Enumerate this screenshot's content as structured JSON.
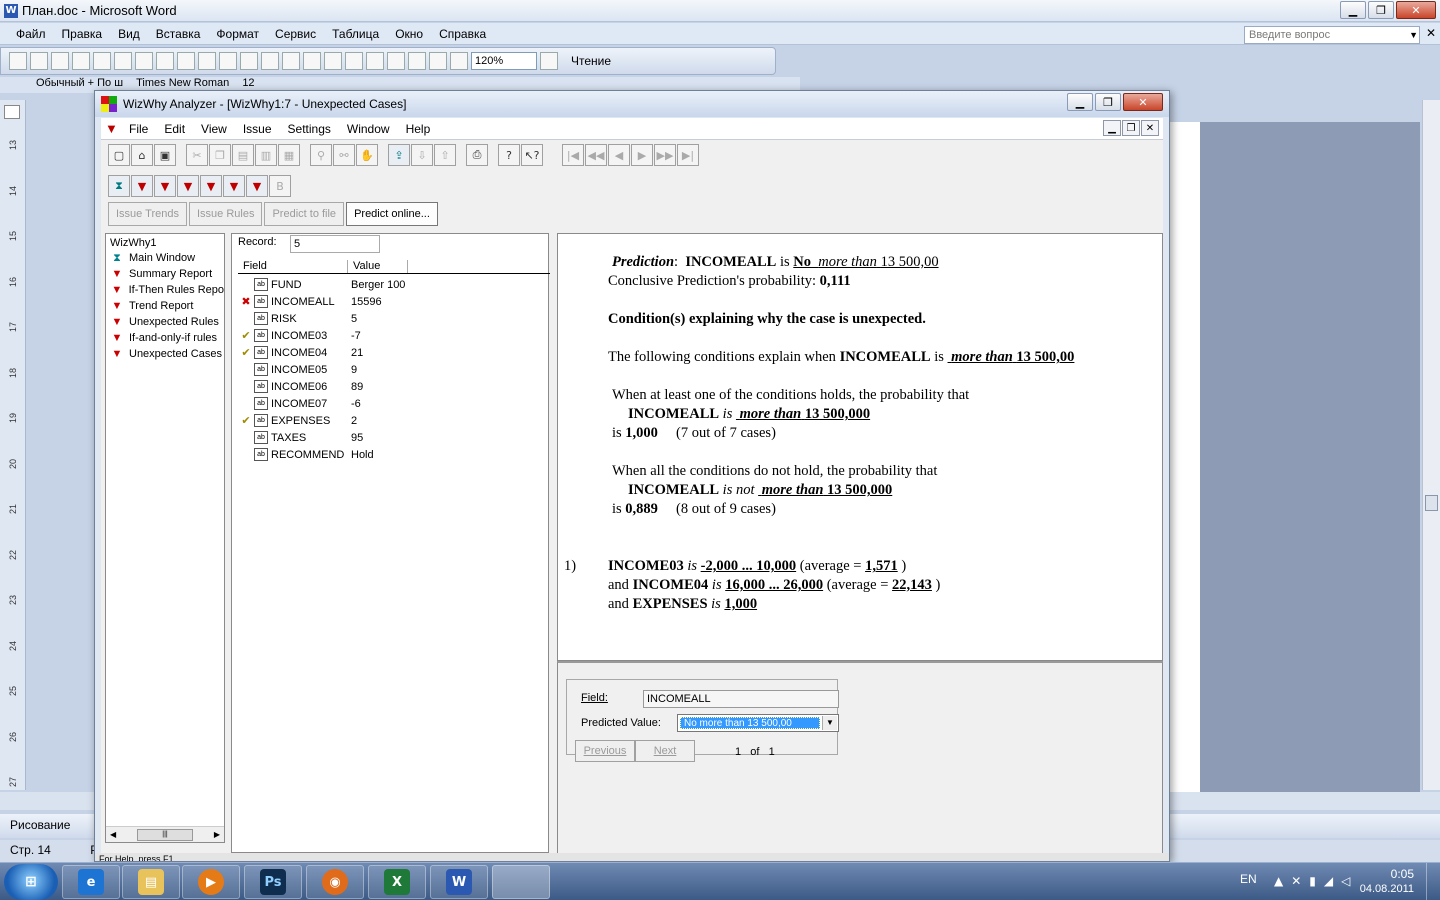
{
  "word": {
    "title": "План.doc - Microsoft Word",
    "menu": [
      "Файл",
      "Правка",
      "Вид",
      "Вставка",
      "Формат",
      "Сервис",
      "Таблица",
      "Окно",
      "Справка"
    ],
    "ask_placeholder": "Введите вопрос",
    "zoom": "120%",
    "read_label": "Чтение",
    "style_combo": "Обычный + По ш",
    "font_combo": "Times New Roman",
    "size_combo": "12",
    "ruler_numbers": [
      "13",
      "14",
      "15",
      "16",
      "17",
      "18",
      "19",
      "20",
      "21",
      "22",
      "23",
      "24",
      "25",
      "26",
      "27"
    ],
    "draw_label": "Рисование",
    "status_page": "Стр. 14",
    "status_number": "Р"
  },
  "wiz": {
    "title": "WizWhy Analyzer - [WizWhy1:7 - Unexpected Cases]",
    "menu": [
      "File",
      "Edit",
      "View",
      "Issue",
      "Settings",
      "Window",
      "Help"
    ],
    "action_buttons": [
      "Issue Trends",
      "Issue Rules",
      "Predict to file",
      "Predict online..."
    ],
    "tree": {
      "root": "WizWhy1",
      "items": [
        "Main Window",
        "Summary Report",
        "If-Then Rules Repo",
        "Trend Report",
        "Unexpected Rules",
        "If-and-only-if rules",
        "Unexpected Cases"
      ]
    },
    "record": {
      "label": "Record:",
      "value": "5",
      "col_field": "Field",
      "col_value": "Value",
      "rows": [
        {
          "mark": "",
          "field": "FUND",
          "value": "Berger 100"
        },
        {
          "mark": "x",
          "field": "INCOMEALL",
          "value": "15596"
        },
        {
          "mark": "",
          "field": "RISK",
          "value": "5"
        },
        {
          "mark": "ok",
          "field": "INCOME03",
          "value": "-7"
        },
        {
          "mark": "ok",
          "field": "INCOME04",
          "value": "21"
        },
        {
          "mark": "",
          "field": "INCOME05",
          "value": "9"
        },
        {
          "mark": "",
          "field": "INCOME06",
          "value": "89"
        },
        {
          "mark": "",
          "field": "INCOME07",
          "value": "-6"
        },
        {
          "mark": "ok",
          "field": "EXPENSES",
          "value": "2"
        },
        {
          "mark": "",
          "field": "TAXES",
          "value": "95"
        },
        {
          "mark": "",
          "field": "RECOMMEND",
          "value": "Hold"
        }
      ]
    },
    "doc": {
      "pred_label": "Prediction",
      "pred_colon": ":",
      "pred_field": "INCOMEALL",
      "is": "is",
      "pred_no": "No",
      "pred_more": "more than",
      "pred_amount": "13 500,00",
      "concl_text": "Conclusive Prediction's probability:",
      "concl_value": "0,111",
      "cond_heading": "Condition(s) explaining why the case is unexpected.",
      "following_text": "The following conditions explain when",
      "following_field": "INCOMEALL",
      "following_is": "is",
      "following_more": "more than",
      "following_amount": "13 500,00",
      "atleast_text": "When at least one of the conditions holds, the probability that",
      "atleast_field": "INCOMEALL",
      "atleast_is": "is",
      "atleast_more": "more than",
      "atleast_amount": "13 500,000",
      "atleast_prob_is": "is",
      "atleast_prob": "1,000",
      "atleast_cases": "(7 out of 7 cases)",
      "all_text": "When all the conditions do not hold, the probability that",
      "all_field": "INCOMEALL",
      "all_isnot": "is not",
      "all_more": "more than",
      "all_amount": "13 500,000",
      "all_prob_is": "is",
      "all_prob": "0,889",
      "all_cases": "(8 out of 9 cases)",
      "cond_num": "1)",
      "c1_field": "INCOME03",
      "c1_is": "is",
      "c1_range": "-2,000 ... 10,000",
      "c1_avg_pre": "(average =",
      "c1_avg": "1,571",
      "c1_avg_post": ")",
      "c2_and": "and",
      "c2_field": "INCOME04",
      "c2_is": "is",
      "c2_range": "16,000 ... 26,000",
      "c2_avg_pre": "(average =",
      "c2_avg": "22,143",
      "c2_avg_post": ")",
      "c3_and": "and",
      "c3_field": "EXPENSES",
      "c3_is": "is",
      "c3_value": "1,000"
    },
    "pred_panel": {
      "field_label": "Field:",
      "field_value": "INCOMEALL",
      "pv_label": "Predicted Value:",
      "pv_selected": "No  more than 13 500,00",
      "previous": "Previous",
      "next": "Next",
      "page_current": "1",
      "page_of": "of",
      "page_total": "1"
    },
    "status": "For Help, press F1"
  },
  "taskbar": {
    "lang": "EN",
    "time": "0:05",
    "date": "04.08.2011"
  }
}
